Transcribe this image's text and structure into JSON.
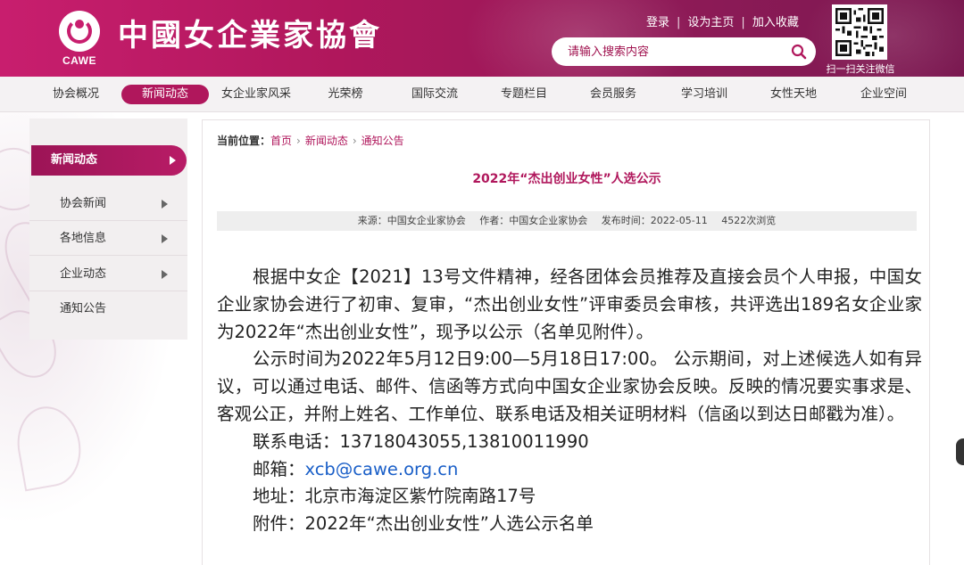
{
  "header": {
    "org_name": "中國女企業家協會",
    "org_abbr": "CAWE",
    "top_links": [
      "登录",
      "设为主页",
      "加入收藏"
    ],
    "search": {
      "placeholder": "请输入搜索内容"
    },
    "qr_caption": "扫一扫关注微信"
  },
  "nav": {
    "items": [
      "协会概况",
      "新闻动态",
      "女企业家风采",
      "光荣榜",
      "国际交流",
      "专题栏目",
      "会员服务",
      "学习培训",
      "女性天地",
      "企业空间"
    ],
    "active": "新闻动态"
  },
  "sidebar": {
    "heading": "新闻动态",
    "items": [
      "协会新闻",
      "各地信息",
      "企业动态",
      "通知公告"
    ]
  },
  "breadcrumb": {
    "label": "当前位置：",
    "items": [
      "首页",
      "新闻动态",
      "通知公告"
    ]
  },
  "article": {
    "title": "2022年“杰出创业女性”人选公示",
    "meta": {
      "source": "来源：中国女企业家协会",
      "author": "作者：中国女企业家协会",
      "published": "发布时间：2022-05-11",
      "views": "4522次浏览"
    },
    "paragraphs": [
      "根据中女企【2021】13号文件精神，经各团体会员推荐及直接会员个人申报，中国女企业家协会进行了初审、复审，“杰出创业女性”评审委员会审核，共评选出189名女企业家为2022年“杰出创业女性”，现予以公示（名单见附件）。",
      "公示时间为2022年5月12日9:00—5月18日17:00。 公示期间，对上述候选人如有异议，可以通过电话、邮件、信函等方式向中国女企业家协会反映。反映的情况要实事求是、客观公正，并附上姓名、工作单位、联系电话及相关证明材料（信函以到达日邮戳为准）。"
    ],
    "phone": "联系电话：13718043055,13810011990",
    "email_label": "邮箱：",
    "email": "xcb@cawe.org.cn",
    "address": "地址：北京市海淀区紫竹院南路17号",
    "attachment": "附件：2022年“杰出创业女性”人选公示名单"
  }
}
